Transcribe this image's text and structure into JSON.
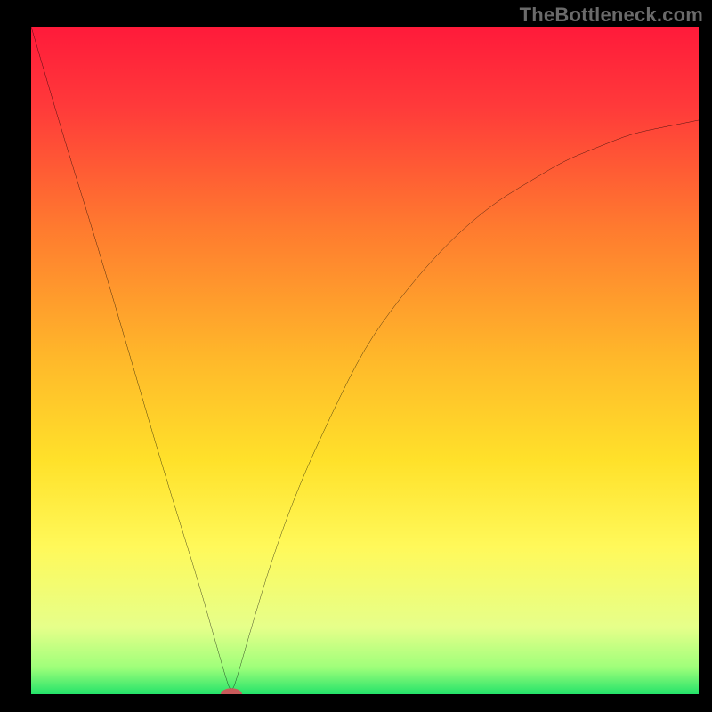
{
  "watermark": "TheBottleneck.com",
  "chart_data": {
    "type": "line",
    "title": "",
    "xlabel": "",
    "ylabel": "",
    "xlim": [
      0,
      100
    ],
    "ylim": [
      0,
      100
    ],
    "series": [
      {
        "name": "curve",
        "x": [
          0,
          5,
          10,
          15,
          20,
          25,
          27,
          29,
          30,
          31,
          33,
          36,
          40,
          45,
          50,
          55,
          60,
          65,
          70,
          75,
          80,
          85,
          90,
          95,
          100
        ],
        "y": [
          100,
          83,
          67,
          50,
          33,
          17,
          10,
          3,
          0,
          3,
          10,
          20,
          31,
          42,
          52,
          59,
          65,
          70,
          74,
          77,
          80,
          82,
          84,
          85,
          86
        ]
      }
    ],
    "marker": {
      "x": 30,
      "y": 0
    },
    "gradient_stops": [
      {
        "offset": 0.0,
        "color": "#ff1a3a"
      },
      {
        "offset": 0.12,
        "color": "#ff3a3a"
      },
      {
        "offset": 0.3,
        "color": "#ff7a2f"
      },
      {
        "offset": 0.5,
        "color": "#ffb92a"
      },
      {
        "offset": 0.65,
        "color": "#ffe12a"
      },
      {
        "offset": 0.78,
        "color": "#fff95a"
      },
      {
        "offset": 0.9,
        "color": "#e6ff8a"
      },
      {
        "offset": 0.96,
        "color": "#9fff7a"
      },
      {
        "offset": 1.0,
        "color": "#24e36a"
      }
    ]
  }
}
